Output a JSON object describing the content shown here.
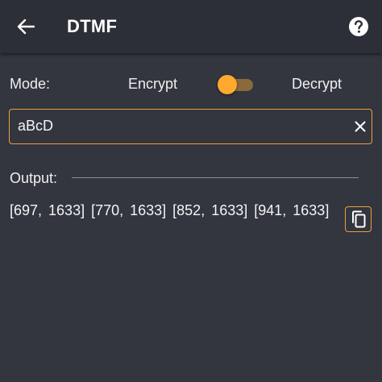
{
  "appbar": {
    "title": "DTMF",
    "back_icon": "arrow-back-icon",
    "help_icon": "help-circle-icon"
  },
  "mode": {
    "label": "Mode:",
    "option_left": "Encrypt",
    "option_right": "Decrypt",
    "toggle_state": "encrypt"
  },
  "input": {
    "value": "aBcD",
    "clear_icon": "close-icon"
  },
  "output": {
    "label": "Output:",
    "text": "[697, 1633] [770, 1633] [852, 1633] [941, 1633]",
    "copy_icon": "copy-icon"
  },
  "colors": {
    "background": "#33353f",
    "appbar": "#2d2f38",
    "accent": "#ffaa2e",
    "border_accent": "#e8a23b"
  }
}
